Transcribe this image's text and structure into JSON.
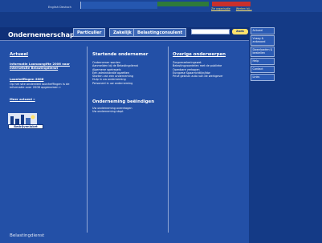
{
  "top": {
    "language_links": "English  Deutsch",
    "top_links": [
      "Zie organisatie",
      "Werken bij..."
    ]
  },
  "brand": {
    "title": "Ondernemerschap"
  },
  "tabs": [
    "Particulier",
    "Zakelijk",
    "Belastingconsulent"
  ],
  "search": {
    "button_label": "Zoek"
  },
  "left": {
    "heading": "Actueel",
    "news1_title": "Informatie Loonaangifte 2006 naar internetsite Belastingdienst",
    "news2_title": "Loonheffingen 2006",
    "news2_text": "Op het site onderdeel loonheffingen is de informatie over 2006 opgenomen »",
    "more_link": "Meer actueel »",
    "logo_label": "Bedrijvenloket"
  },
  "middle": {
    "heading1": "Startende ondernemer",
    "links1": [
      "Ondernemer worden",
      "Aanmelden bij de Belastingdienst",
      "Algemene spelregels",
      "Een administratie opzetten",
      "Starten van een onderneming",
      "Hulp in uw onderneming",
      "Personeel in uw onderneming"
    ],
    "heading2": "Onderneming beëindigen",
    "links2": [
      "Uw onderneming overdragen",
      "Uw onderneming stopt"
    ]
  },
  "right": {
    "heading": "Overige onderwerpen",
    "links": [
      "Zorgverzekeringswet",
      "Belastingvoordelen met de publieke",
      "Openbare verkopen",
      "Europese Spaarrichtlijn/btw",
      "Privé gebruik auto van de werkgever"
    ]
  },
  "sidebar": {
    "items": [
      "Actueel",
      "Vraag & antwoord",
      "Downloaden & bestellen",
      "Help",
      "Contact",
      "Links"
    ]
  },
  "footer": {
    "label": "Belastingdienst"
  },
  "colors": {
    "background": "#143a86",
    "panel": "#2350a7",
    "accent": "#ffe16b"
  }
}
